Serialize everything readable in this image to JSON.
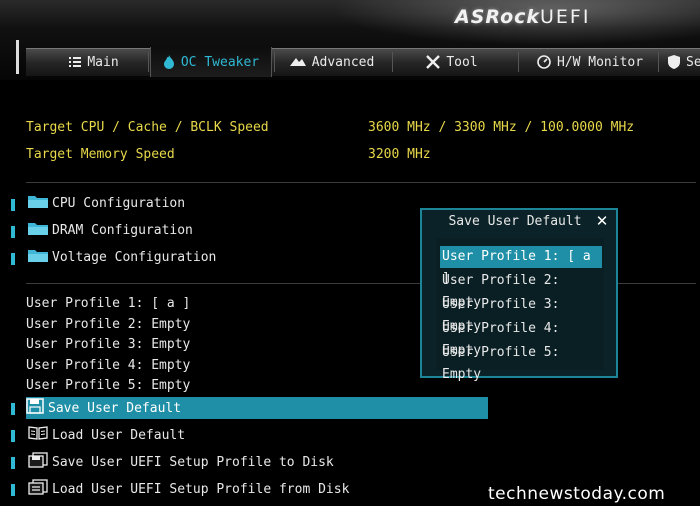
{
  "header": {
    "brand": "ASRock",
    "product": "UEFI"
  },
  "tabs": [
    {
      "label": "Main",
      "icon": "list-icon"
    },
    {
      "label": "OC Tweaker",
      "icon": "flame-icon",
      "active": true
    },
    {
      "label": "Advanced",
      "icon": "advanced-icon"
    },
    {
      "label": "Tool",
      "icon": "tool-icon"
    },
    {
      "label": "H/W Monitor",
      "icon": "monitor-icon"
    },
    {
      "label": "Se",
      "icon": "security-icon"
    }
  ],
  "info": [
    {
      "label": "Target CPU / Cache / BCLK Speed",
      "value": "3600 MHz / 3300 MHz / 100.0000 MHz"
    },
    {
      "label": "Target Memory Speed",
      "value": "3200 MHz"
    }
  ],
  "submenus": [
    {
      "label": "CPU Configuration",
      "icon": "folder-icon"
    },
    {
      "label": "DRAM Configuration",
      "icon": "folder-icon"
    },
    {
      "label": "Voltage Configuration",
      "icon": "folder-icon"
    }
  ],
  "profiles": [
    "User Profile 1: [ a ]",
    "User Profile 2: Empty",
    "User Profile 3: Empty",
    "User Profile 4: Empty",
    "User Profile 5: Empty"
  ],
  "actions": [
    {
      "label": "Save User Default",
      "icon": "save-icon",
      "selected": true
    },
    {
      "label": "Load User Default",
      "icon": "load-icon"
    },
    {
      "label": "Save User UEFI Setup Profile to Disk",
      "icon": "save-disk-icon"
    },
    {
      "label": "Load User UEFI Setup Profile from Disk",
      "icon": "load-disk-icon"
    }
  ],
  "dialog": {
    "title": "Save User Default",
    "close": "✕",
    "items": [
      "User Profile 1: [ a ]",
      "User Profile 2: Empty",
      "User Profile 3: Empty",
      "User Profile 4: Empty",
      "User Profile 5: Empty"
    ],
    "selected_index": 0
  },
  "watermark": "technewstoday.com",
  "colors": {
    "accent": "#1e8fa6",
    "info_text": "#e8d84a",
    "active_tab_text": "#2fb9d4"
  }
}
